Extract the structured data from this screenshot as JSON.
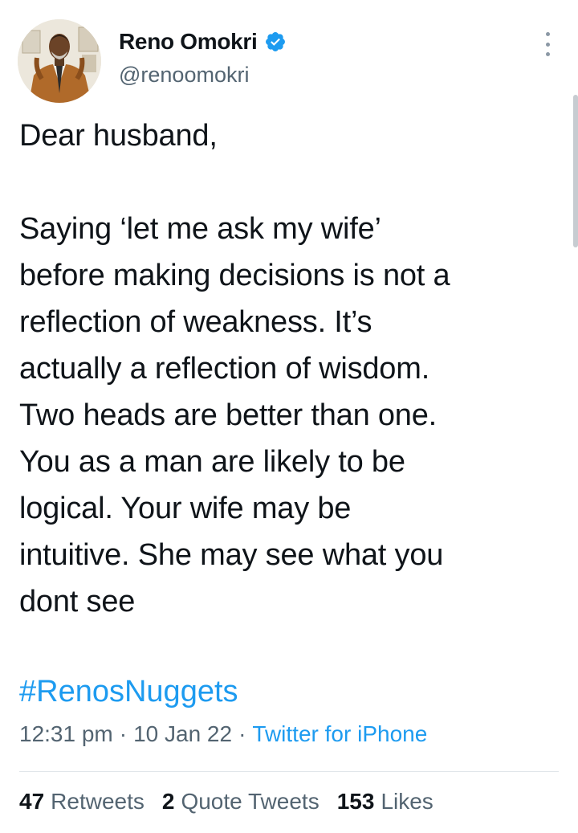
{
  "author": {
    "display_name": "Reno Omokri",
    "handle": "@renoomokri",
    "verified": true,
    "verified_color": "#1d9bf0"
  },
  "tweet": {
    "lines_para1": [
      "Dear husband,"
    ],
    "lines_para2": [
      "Saying ‘let me ask my wife’",
      "before making decisions is not a",
      "reflection of weakness. It’s",
      "actually a reflection of wisdom.",
      "Two heads are better than one.",
      "You as a man are likely to be",
      "logical. Your wife may be",
      "intuitive. She may see what you",
      "dont see"
    ],
    "hashtag": "#RenosNuggets"
  },
  "meta": {
    "time": "12:31 pm",
    "separator": "·",
    "date": "10 Jan 22",
    "source": "Twitter for iPhone"
  },
  "stats": {
    "retweets_count": "47",
    "retweets_label": "Retweets",
    "quotes_count": "2",
    "quotes_label": "Quote Tweets",
    "likes_count": "153",
    "likes_label": "Likes"
  },
  "icons": {
    "verified": "verified-badge-icon",
    "more": "more-options-icon"
  },
  "colors": {
    "link": "#1d9bf0",
    "secondary_text": "#536471",
    "primary_text": "#0f1419"
  }
}
